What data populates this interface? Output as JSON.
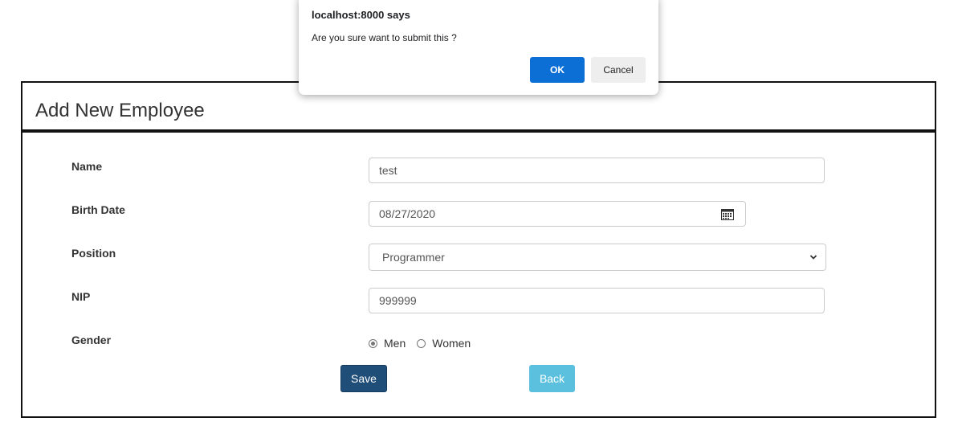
{
  "dialog": {
    "title": "localhost:8000 says",
    "message": "Are you sure want to submit this ?",
    "ok_label": "OK",
    "cancel_label": "Cancel"
  },
  "form": {
    "title": "Add New Employee",
    "fields": {
      "name": {
        "label": "Name",
        "value": "test"
      },
      "birth_date": {
        "label": "Birth Date",
        "value": "08/27/2020"
      },
      "position": {
        "label": "Position",
        "value": "Programmer"
      },
      "nip": {
        "label": "NIP",
        "value": "999999"
      },
      "gender": {
        "label": "Gender",
        "options": [
          "Men",
          "Women"
        ],
        "selected": "Men"
      }
    },
    "save_label": "Save",
    "back_label": "Back"
  },
  "colors": {
    "save_button": "#1f4e79",
    "back_button": "#5bc0de",
    "dialog_ok": "#0b6fd6"
  },
  "icons": {
    "date": "calendar-icon",
    "select": "chevron-down-icon"
  }
}
